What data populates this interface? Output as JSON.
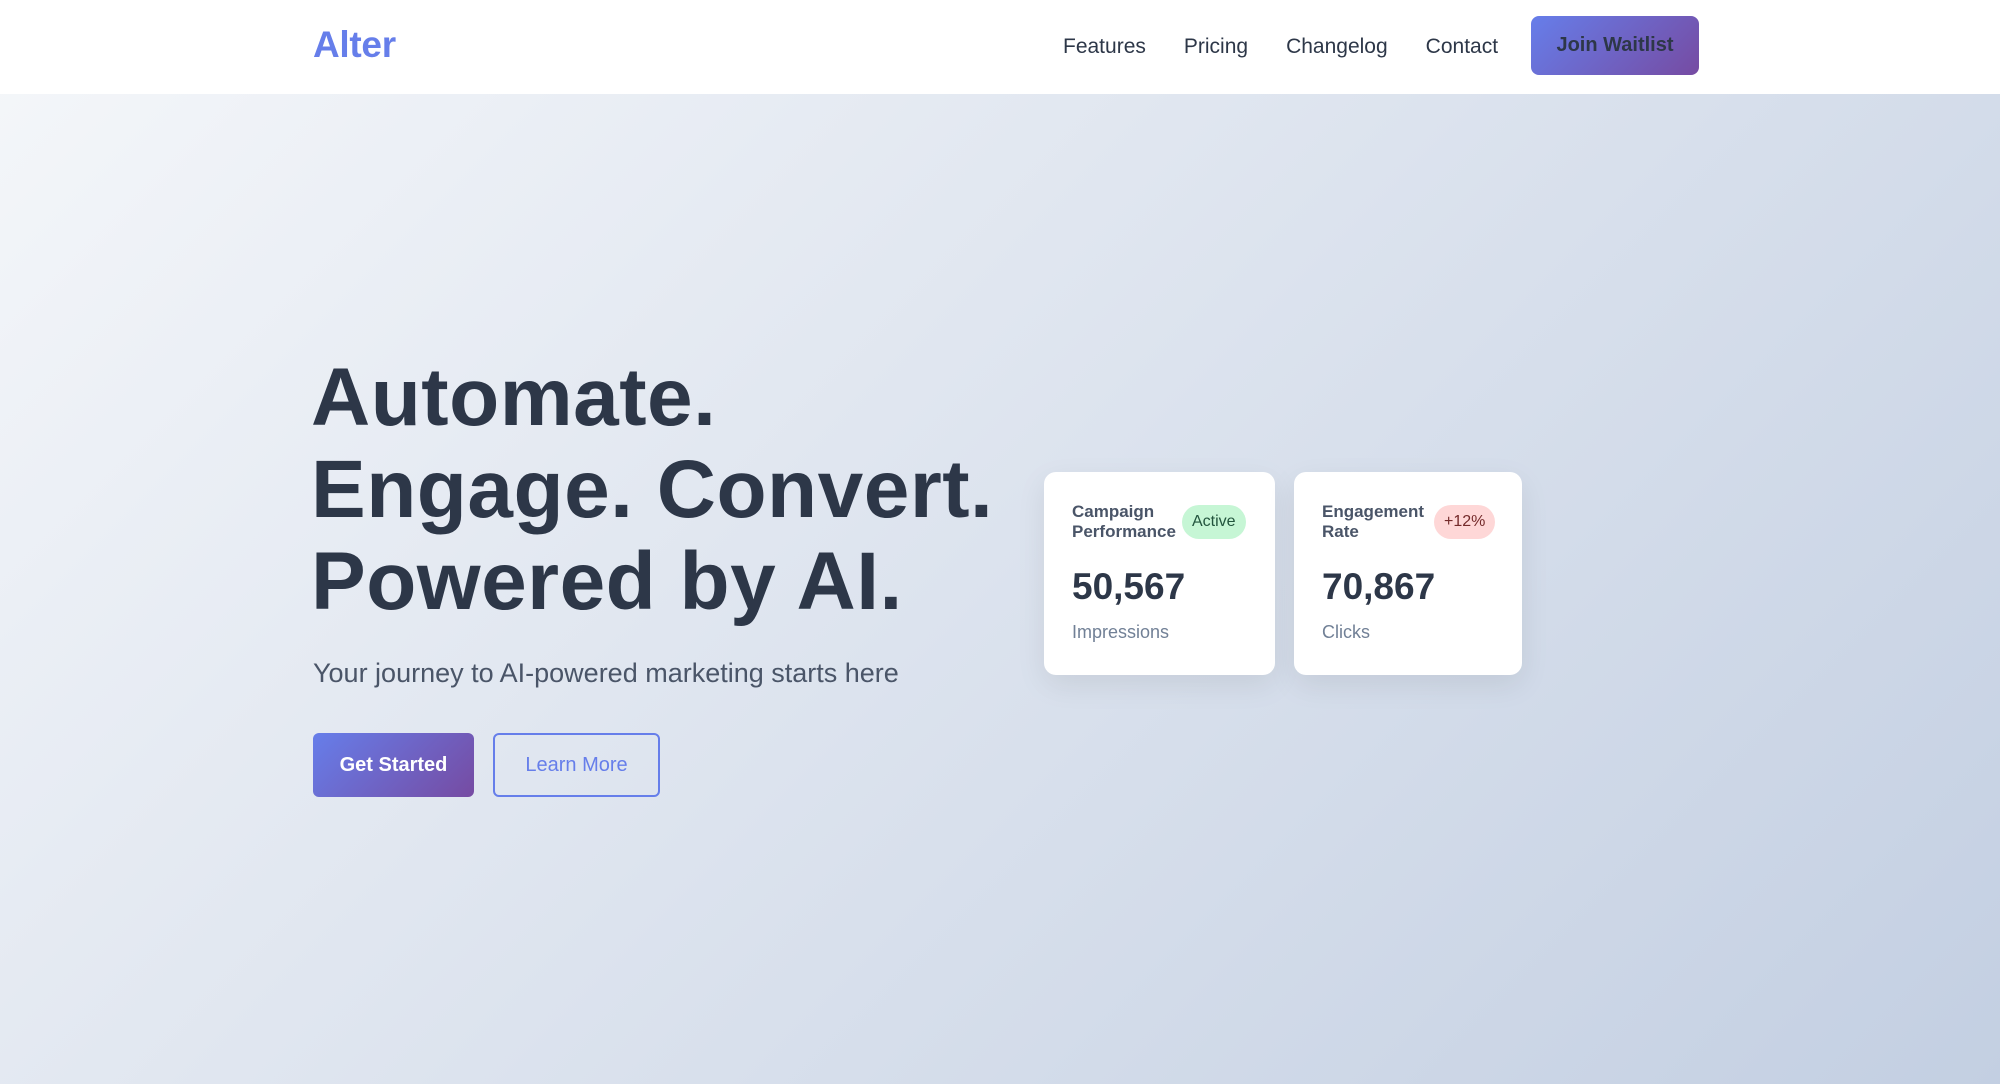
{
  "nav": {
    "logo": "Alter",
    "links": [
      "Features",
      "Pricing",
      "Changelog",
      "Contact"
    ],
    "cta": "Join Waitlist"
  },
  "hero": {
    "title_lines": [
      "Automate.",
      "Engage. Convert.",
      "Powered by AI."
    ],
    "subtitle": "Your journey to AI-powered marketing starts here",
    "primary_button": "Get Started",
    "secondary_button": "Learn More"
  },
  "cards": [
    {
      "title": "Campaign Performance",
      "badge": "Active",
      "value": "50,567",
      "label": "Impressions"
    },
    {
      "title": "Engagement Rate",
      "badge": "+12%",
      "value": "70,867",
      "label": "Clicks"
    }
  ],
  "colors": {
    "accent": "#667eea",
    "accent_end": "#764ba2",
    "text": "#2d3748",
    "badge_active_bg": "#c6f6d5",
    "badge_growth_bg": "#fed7d7"
  }
}
